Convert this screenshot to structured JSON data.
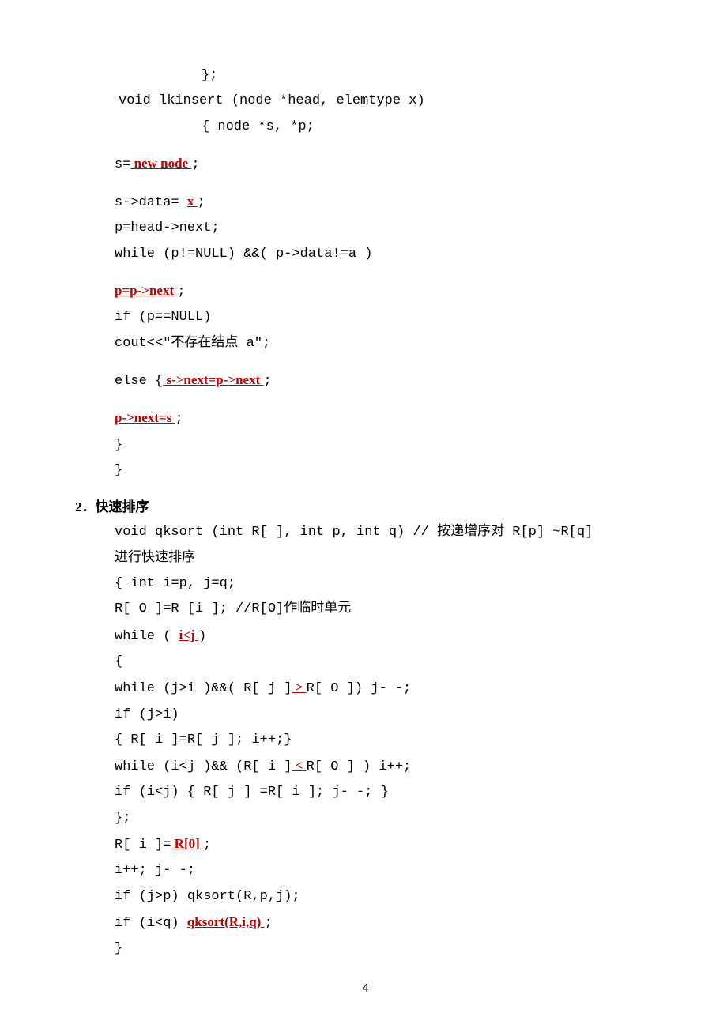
{
  "block1": {
    "l1": "};",
    "l2": "void lkinsert (node *head, elemtype x)",
    "l3": "{ node *s, *p;",
    "l4_pre": "s=",
    "l4_ans": "   new node   ",
    "l4_post": ";",
    "l5_pre": "s->data= ",
    "l5_ans": "   x   ",
    "l5_post": ";",
    "l6": " p=head->next;",
    "l7": "while (p!=NULL) &&( p->data!=a )",
    "l8_ans": "                           p=p->next               ",
    "l8_post": ";",
    "l9": "if (p==NULL)",
    "l10": "cout<<\"不存在结点 a\";",
    "l11_pre": "else {",
    "l11_ans": "                        s->next=p->next                              ",
    "l11_post": ";",
    "l12_ans": "                              p->next=s                           ",
    "l12_post": ";",
    "l13": "}",
    "l14": "}"
  },
  "block2": {
    "heading": "2．快速排序",
    "l1": "void  qksort (int R[ ], int p, int q)     // 按递增序对 R[p] ~R[q]",
    "l2": "进行快速排序",
    "l3": "{  int i=p, j=q;",
    "l4": "R[ O ]=R [i ];          //R[O]作临时单元",
    "l5_pre": "  while ( ",
    "l5_ans": "   i<j      ",
    "l5_post": " )",
    "l6": "    {",
    "l7_pre": "while (j>i )&&( R[ j ]",
    "l7_ans": "  >  ",
    "l7_post": "R[ O ])  j- -;",
    "l8": " if (j>i)",
    "l9": "     { R[ i ]=R[ j ];  i++;}",
    "l10_pre": "while (i<j )&& (R[ i ]",
    "l10_ans": "  <  ",
    "l10_post": "R[ O ] )  i++;",
    "l11": "        if (i<j)  { R[ j ] =R[ i ];  j- -; }",
    "l12": " };",
    "l13_pre": "R[ i ]=",
    "l13_ans": "  R[0]    ",
    "l13_post": ";",
    "l14": "          i++;  j- -;",
    "l15": "if (j>p) qksort(R,p,j);",
    "l16_pre": "if (i<q) ",
    "l16_ans": "        qksort(R,i,q)            ",
    "l16_post": ";",
    "l17": " }"
  },
  "pagenum": "4"
}
